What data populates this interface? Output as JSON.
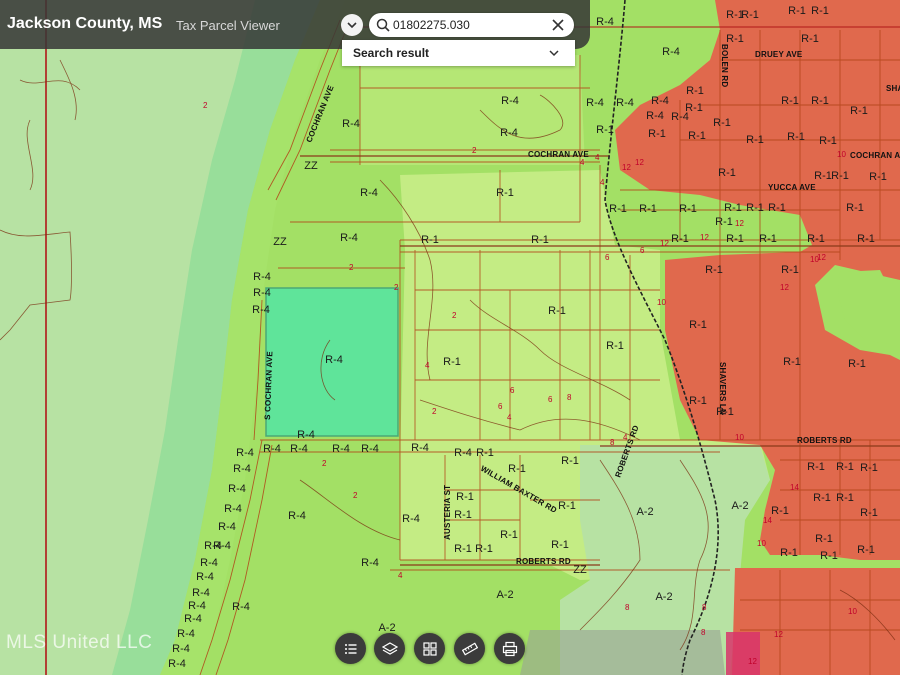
{
  "app": {
    "title": "Jackson County, MS",
    "subtitle": "Tax Parcel Viewer"
  },
  "search": {
    "value": "01802275.030",
    "result_label": "Search result"
  },
  "toolbar": {
    "items": [
      "list",
      "layers",
      "grid",
      "measure",
      "print"
    ]
  },
  "watermark": "MLS United LLC",
  "colors": {
    "r1_residential": "#e0694d",
    "r4_zone": "#a3e065",
    "r1_light_zone": "#c4ec84",
    "a2_zone": "#b7e2a3",
    "subject_parcel": "#5fe49a",
    "river": "#98de9a",
    "parcel_lines": "#b24418",
    "elevation_text": "#c0002a",
    "county_line": "#b01818",
    "railroad": "#222222"
  },
  "roads": {
    "cochran_ave": "COCHRAN AVE",
    "s_cochran_ave": "S COCHRAN AVE",
    "roberts_rd": "ROBERTS RD",
    "bolen_rd": "BOLEN RD",
    "druey_ave": "DRUEY AVE",
    "yucca_ave": "YUCCA AVE",
    "shavers_ln": "SHAVERS LN",
    "william_baxter_rd": "WILLIAM BAXTER RD",
    "austeria_st": "AUSTERIA ST",
    "sha": "SHA"
  },
  "zones": {
    "r4": "R-4",
    "r1": "R-1",
    "a2": "A-2",
    "zz": "ZZ"
  },
  "elevations": [
    "2",
    "4",
    "6",
    "8",
    "10",
    "12",
    "14"
  ]
}
